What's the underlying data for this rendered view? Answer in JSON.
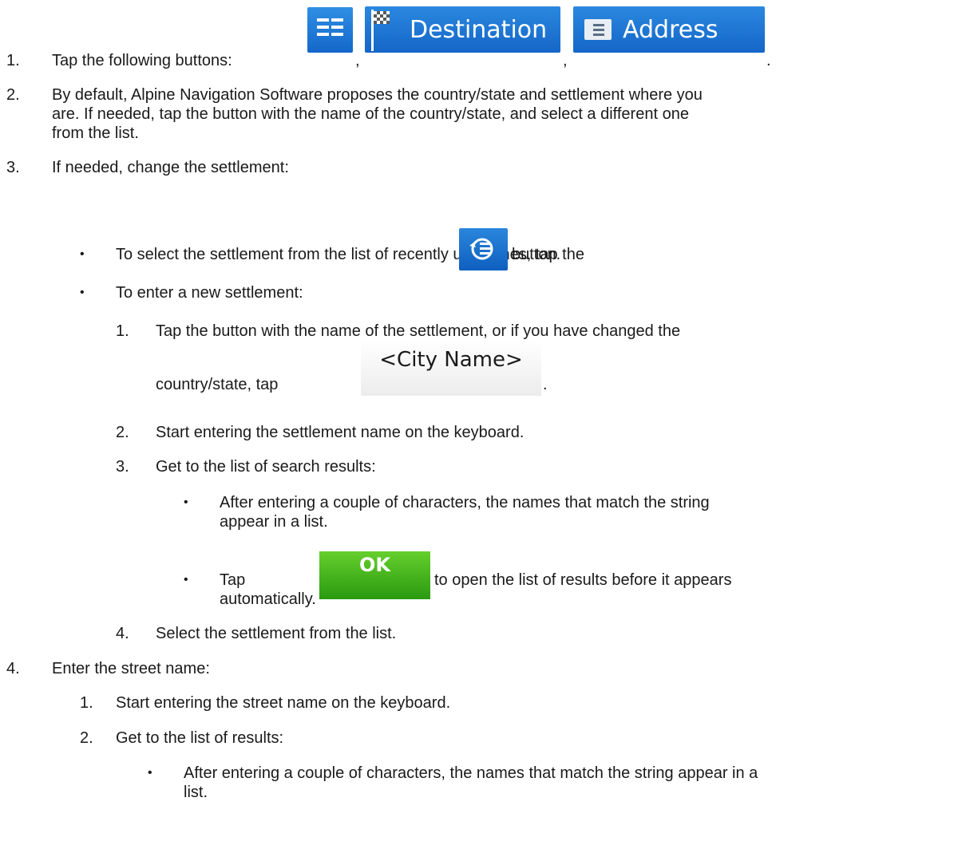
{
  "step1": {
    "num": "1.",
    "text": "Tap the following buttons:",
    "sep1": ",",
    "sep2": ",",
    "end": ".",
    "destination_label": "Destination",
    "address_label": "Address"
  },
  "step2": {
    "num": "2.",
    "line1": "By default, Alpine Navigation Software proposes the country/state and settlement where you",
    "line2": "are. If needed, tap the button with the name of the country/state, and select a different one",
    "line3": "from the list."
  },
  "step3": {
    "num": "3.",
    "text": "If needed, change the settlement:",
    "bullet_a_before": "To select the settlement from the list of recently used ones, tap the",
    "bullet_a_after": "button.",
    "bullet_b": "To enter a new settlement:",
    "sub1_num": "1.",
    "sub1_line1": "Tap the button with the name of the settlement, or if you have changed the",
    "sub1_line2": "country/state, tap",
    "sub1_end": ".",
    "city_button_label": "<City Name>",
    "sub2_num": "2.",
    "sub2_text": "Start entering the settlement name on the keyboard.",
    "sub3_num": "3.",
    "sub3_text": "Get to the list of search results:",
    "sub3_bullet1_line1": "After entering a couple of characters, the names that match the string",
    "sub3_bullet1_line2": "appear in a list.",
    "sub3_bullet2_before": "Tap",
    "sub3_bullet2_after": "to open the list of results before it appears",
    "sub3_bullet2_line2": "automatically.",
    "ok_label": "OK",
    "sub4_num": "4.",
    "sub4_text": "Select the settlement from the list."
  },
  "step4": {
    "num": "4.",
    "text": "Enter the street name:",
    "sub1_num": "1.",
    "sub1_text": "Start entering the street name on the keyboard.",
    "sub2_num": "2.",
    "sub2_text": "Get to the list of results:",
    "bullet_line1": "After entering a couple of characters, the names that match the string appear in a",
    "bullet_line2": "list."
  },
  "colors": {
    "button_blue": "#1f78d6",
    "ok_green": "#3aaa1a",
    "text": "#1a1a1a"
  },
  "icons": [
    "main-menu-icon",
    "checkered-flag-icon",
    "address-card-icon",
    "history-list-icon"
  ]
}
